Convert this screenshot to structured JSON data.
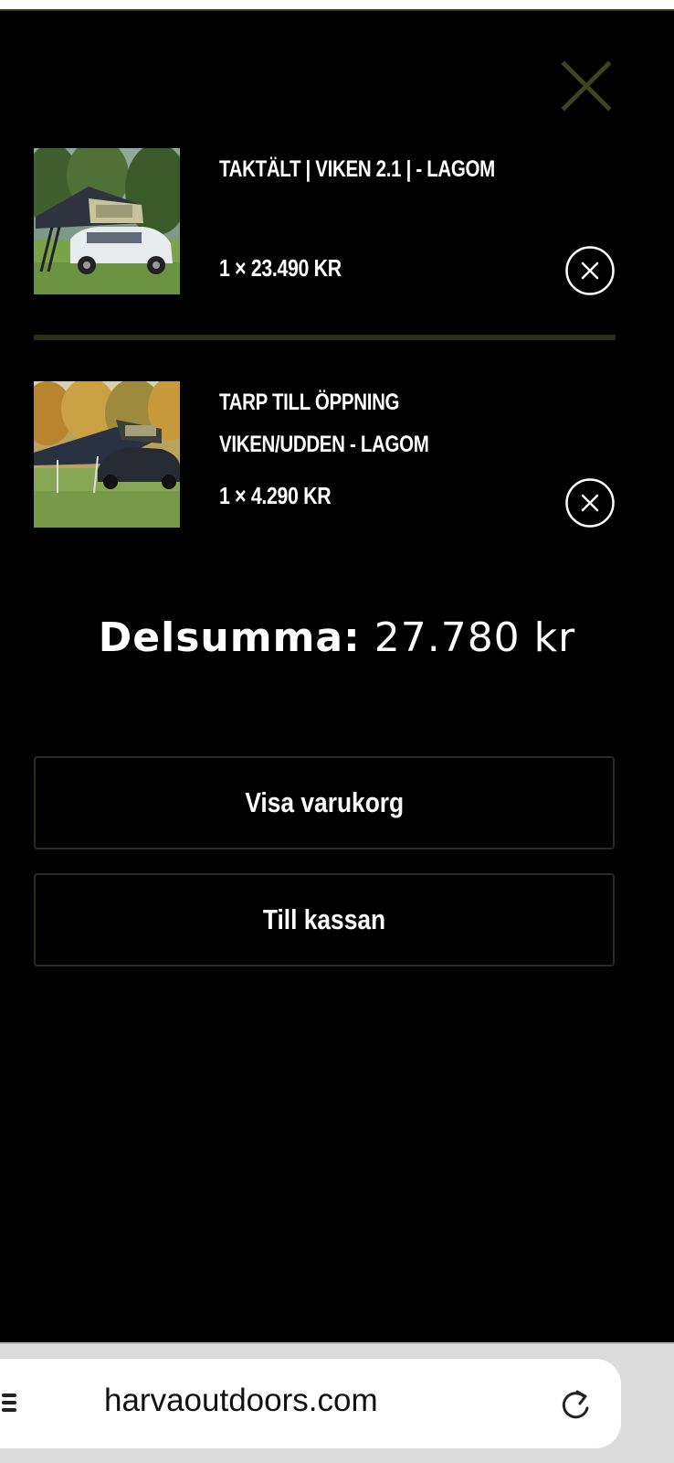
{
  "cart": {
    "items": [
      {
        "title": "TAKTÄLT | VIKEN 2.1 | - LAGOM",
        "quantity_price": "1 × 23.490 KR"
      },
      {
        "title": "TARP TILL ÖPPNING VIKEN/UDDEN - LAGOM",
        "quantity_price": "1 × 4.290 KR"
      }
    ],
    "subtotal_label": "Delsumma:",
    "subtotal_value": "27.780 kr",
    "view_cart_label": "Visa varukorg",
    "checkout_label": "Till kassan"
  },
  "browser": {
    "url": "harvaoutdoors.com"
  },
  "icons": {
    "close": "close-icon",
    "remove": "remove-circle-x-icon",
    "reload": "reload-icon",
    "page_menu": "page-menu-icon"
  },
  "colors": {
    "background": "#000000",
    "accent_olive": "#3a3f1c",
    "close_icon": "#3d4420",
    "browser_bar": "#dcdcdc"
  }
}
